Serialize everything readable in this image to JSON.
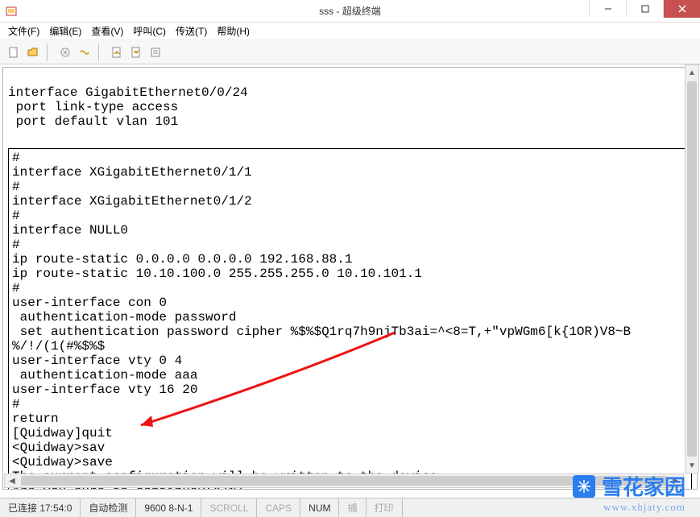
{
  "title": "sss - 超级终端",
  "menus": [
    "文件(F)",
    "编辑(E)",
    "查看(V)",
    "呼叫(C)",
    "传送(T)",
    "帮助(H)"
  ],
  "toolbar_icons": [
    "new-doc-icon",
    "open-icon",
    "save-icon",
    "connect-icon",
    "disconnect-icon",
    "receive-icon",
    "send-icon",
    "properties-icon"
  ],
  "terminal_top": "interface GigabitEthernet0/0/24\n port link-type access\n port default vlan 101",
  "terminal_box": "#\ninterface XGigabitEthernet0/1/1\n#\ninterface XGigabitEthernet0/1/2\n#\ninterface NULL0\n#\nip route-static 0.0.0.0 0.0.0.0 192.168.88.1\nip route-static 10.10.100.0 255.255.255.0 10.10.101.1\n#\nuser-interface con 0\n authentication-mode password\n set authentication password cipher %$%$Q1rq7h9njTb3ai=^<8=T,+\"vpWGm6[k{1OR)V8~B\n%/!/(1(#%$%$\nuser-interface vty 0 4\n authentication-mode aaa\nuser-interface vty 16 20\n#\nreturn\n[Quidway]quit\n<Quidway>sav\n<Quidway>save\nThe current configuration will be written to the device.\nAre you sure to continue?[Y/N]",
  "status": {
    "conn": "已连接 17:54:0",
    "detect": "自动检测",
    "baud": "9600 8-N-1",
    "scroll": "SCROLL",
    "caps": "CAPS",
    "num": "NUM",
    "capture": "捕",
    "print": "打印"
  },
  "watermark": {
    "brand": "雪花家园",
    "url": "www.xhjaty.com"
  }
}
